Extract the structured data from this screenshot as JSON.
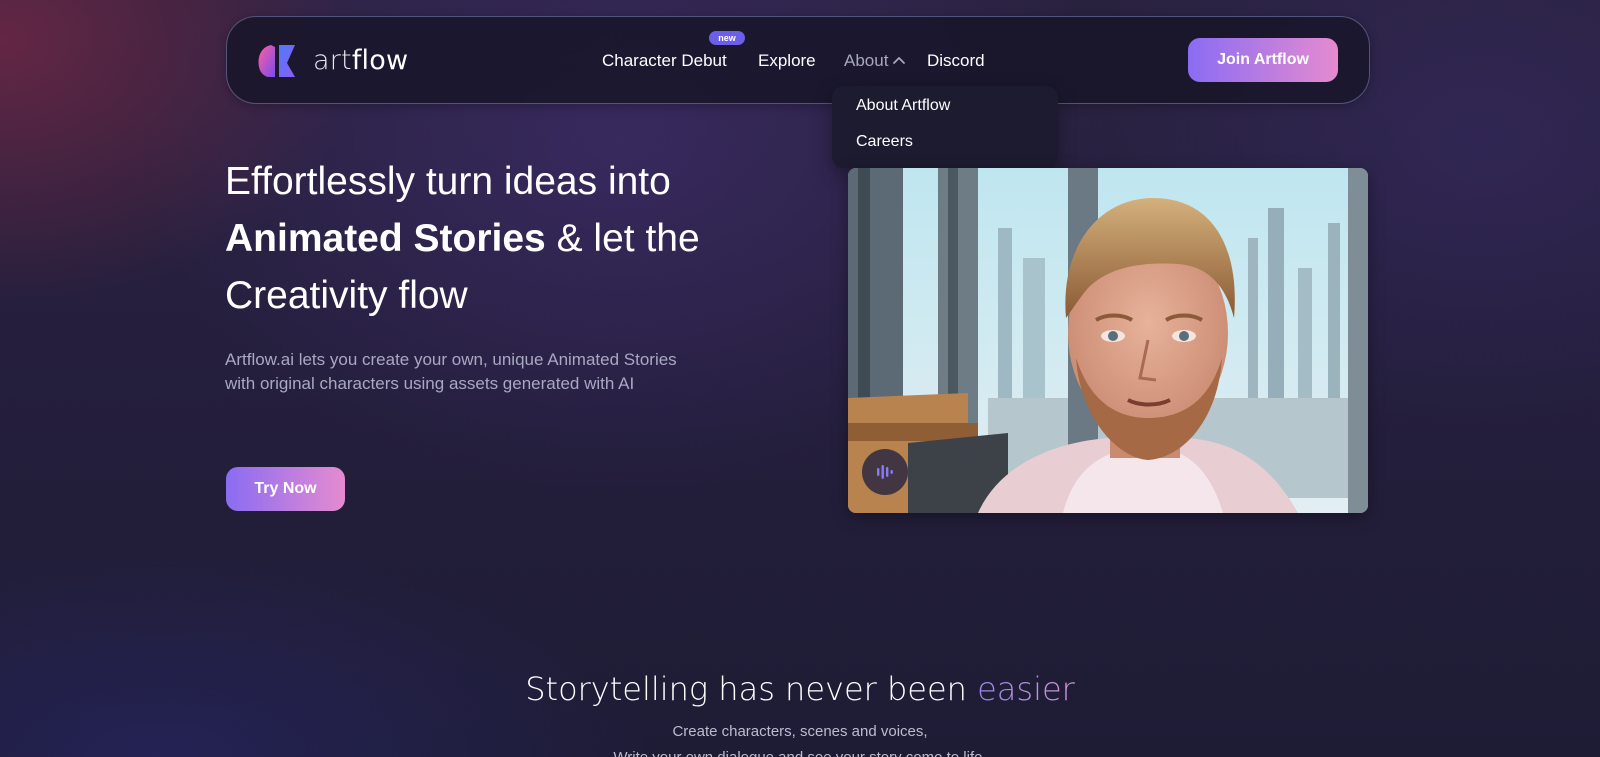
{
  "brand": {
    "name_part1": "art",
    "name_part2": "flow"
  },
  "nav": {
    "items": [
      {
        "label": "Character Debut",
        "badge": "new"
      },
      {
        "label": "Explore"
      },
      {
        "label": "About",
        "expanded": true
      },
      {
        "label": "Discord"
      }
    ],
    "cta_label": "Join Artflow"
  },
  "dropdown": {
    "items": [
      {
        "label": "About Artflow"
      },
      {
        "label": "Careers"
      }
    ]
  },
  "hero": {
    "title_line1": "Effortlessly turn ideas into",
    "title_bold": "Animated Stories",
    "title_line2_rest": " & let the",
    "title_line3": "Creativity flow",
    "desc_line1": "Artflow.ai lets you create your own, unique Animated Stories",
    "desc_line2": "with original characters using assets generated with AI",
    "cta_label": "Try Now"
  },
  "video": {
    "icon": "audio-wave-icon"
  },
  "section": {
    "title_main": "Storytelling has never been ",
    "title_accent": "easier",
    "sub_line1": "Create characters, scenes and voices,",
    "sub_line2": "Write your own dialogue and see your story come to life."
  },
  "colors": {
    "accent_start": "#8a6cf3",
    "accent_end": "#e58bd0",
    "badge": "#6b5ee8",
    "background": "#251f3d"
  }
}
